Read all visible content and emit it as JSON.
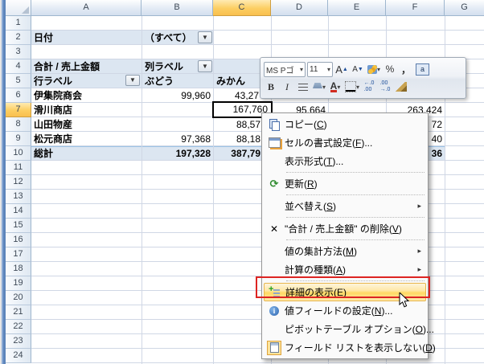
{
  "columns": {
    "letters": [
      "A",
      "B",
      "C",
      "D",
      "E",
      "F",
      "G"
    ],
    "selected": "C"
  },
  "rows": {
    "numbers": [
      "1",
      "2",
      "3",
      "4",
      "5",
      "6",
      "7",
      "8",
      "9",
      "10",
      "11",
      "12",
      "13",
      "14",
      "15",
      "16",
      "17",
      "18",
      "19",
      "20",
      "21",
      "22",
      "23",
      "24"
    ],
    "selected": "7"
  },
  "pivot": {
    "cells": {
      "a2": "日付",
      "b2": "（すべて）",
      "a4": "合計 / 売上金額",
      "b4": "列ラベル",
      "a5": "行ラベル",
      "b5": "ぶどう",
      "c5": "みかん",
      "a6": "伊集院商会",
      "b6": "99,960",
      "c6": "43,27",
      "a7": "滑川商店",
      "c7": "167,760",
      "d7": "95,664",
      "f7": "263,424",
      "a8": "山田物産",
      "c8": "88,57",
      "f8": "72",
      "a9": "松元商店",
      "b9": "97,368",
      "c9": "88,18",
      "f9": "40",
      "a10": "総計",
      "b10": "197,328",
      "c10": "387,79",
      "f10": "36"
    },
    "selected_cell_ref": "C7"
  },
  "mini_toolbar": {
    "font_name": "MS Pゴ",
    "font_size": "11",
    "grow_font": "A",
    "shrink_font": "A",
    "percent": "%",
    "comma": "，",
    "boxa": "a",
    "bold": "B",
    "italic": "I",
    "font_color_a": "A",
    "inc_dec_top": "←.0",
    "inc_dec_bot": ".00",
    "dec_inc_top": ".00",
    "dec_inc_bot": "→.0",
    "caret": "▾"
  },
  "context_menu": {
    "items": [
      {
        "pre": "コピー(",
        "key": "C",
        "post": ")"
      },
      {
        "pre": "セルの書式設定(",
        "key": "F",
        "post": ")..."
      },
      {
        "pre": "表示形式(",
        "key": "T",
        "post": ")..."
      },
      {
        "pre": "更新(",
        "key": "R",
        "post": ")"
      },
      {
        "pre": "並べ替え(",
        "key": "S",
        "post": ")"
      },
      {
        "pre": "\"合計 / 売上金額\" の削除(",
        "key": "V",
        "post": ")"
      },
      {
        "pre": "値の集計方法(",
        "key": "M",
        "post": ")"
      },
      {
        "pre": "計算の種類(",
        "key": "A",
        "post": ")"
      },
      {
        "pre": "詳細の表示(",
        "key": "E",
        "post": ")"
      },
      {
        "pre": "値フィールドの設定(",
        "key": "N",
        "post": ")..."
      },
      {
        "pre": "ピボットテーブル オプション(",
        "key": "O",
        "post": ")..."
      },
      {
        "pre": "フィールド リストを表示しない(",
        "key": "D",
        "post": ")"
      }
    ],
    "submenu_arrow": "▸",
    "ref_glyph": "⟳",
    "x_glyph": "✕",
    "vfs_glyph": "i",
    "highlight_color": "#ffd963",
    "annotation_color": "#dd2422"
  }
}
